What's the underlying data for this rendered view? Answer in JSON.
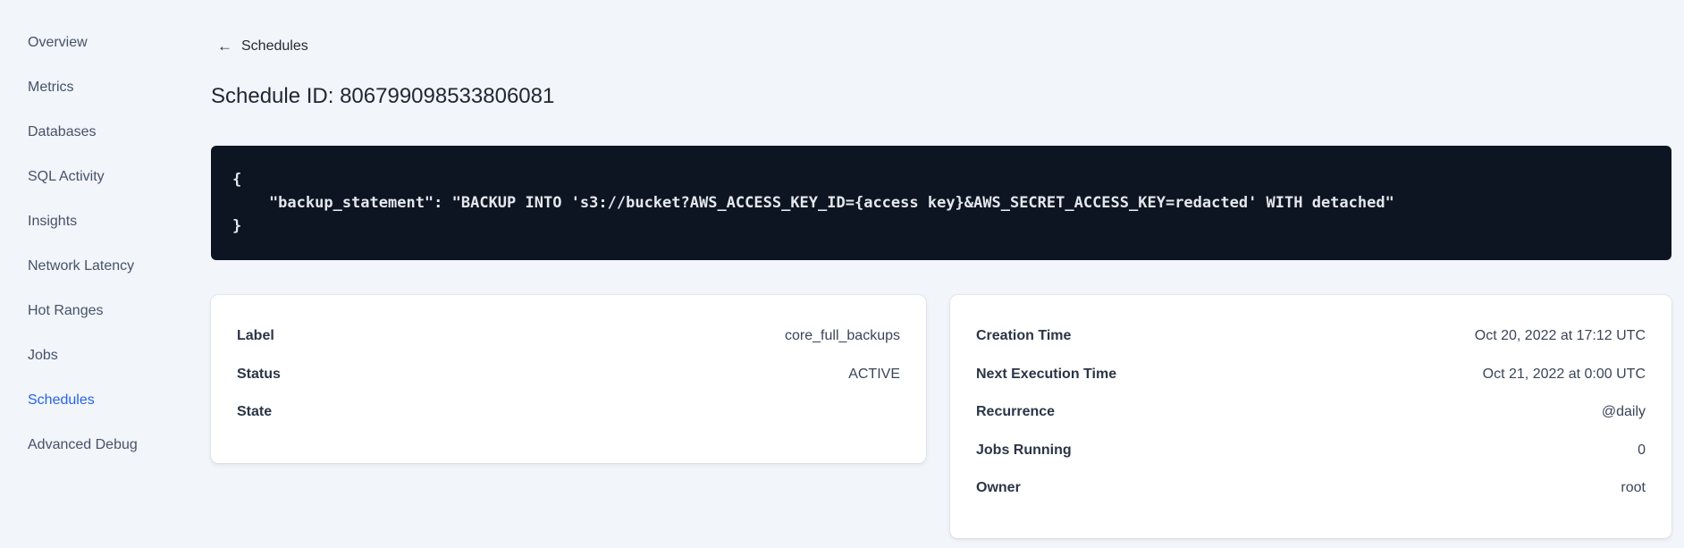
{
  "colors": {
    "page_background": "#f2f5f9",
    "accent_link_blue": "#2563eb",
    "code_block_background": "#0e1522",
    "code_text": "#e4e8ee",
    "card_background": "#ffffff"
  },
  "sidebar": {
    "items": [
      "Overview",
      "Metrics",
      "Databases",
      "SQL Activity",
      "Insights",
      "Network Latency",
      "Hot Ranges",
      "Jobs",
      "Schedules",
      "Advanced Debug"
    ],
    "active_item": "Schedules"
  },
  "main": {
    "back_link_label": "Schedules",
    "back_arrow": "←",
    "page_title": "Schedule ID: 806799098533806081",
    "code_block": "{\n    \"backup_statement\": \"BACKUP INTO 's3://bucket?AWS_ACCESS_KEY_ID={access key}&AWS_SECRET_ACCESS_KEY=redacted' WITH detached\"\n}",
    "schedule_card": {
      "rows": [
        {
          "label": "Label",
          "value": "core_full_backups"
        },
        {
          "label": "Status",
          "value": "ACTIVE"
        },
        {
          "label": "State",
          "value": ""
        }
      ]
    },
    "details_card": {
      "rows": [
        {
          "label": "Creation Time",
          "value": "Oct 20, 2022 at 17:12 UTC"
        },
        {
          "label": "Next Execution Time",
          "value": "Oct 21, 2022 at 0:00 UTC"
        },
        {
          "label": "Recurrence",
          "value": "@daily"
        },
        {
          "label": "Jobs Running",
          "value": "0"
        },
        {
          "label": "Owner",
          "value": "root"
        }
      ]
    }
  }
}
